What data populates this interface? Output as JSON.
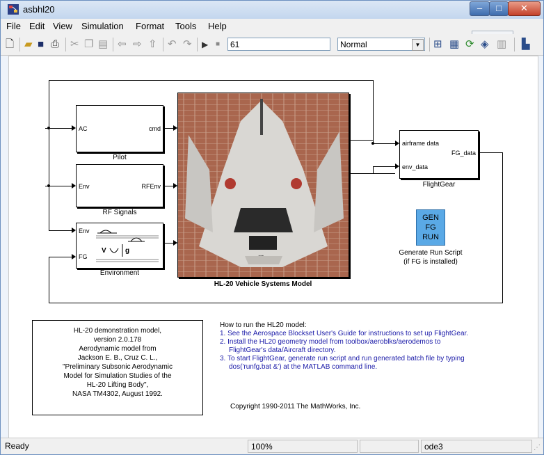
{
  "window": {
    "title": "asbhl20",
    "tooltip": "Minimize"
  },
  "menu": {
    "items": [
      "File",
      "Edit",
      "View",
      "Simulation",
      "Format",
      "Tools",
      "Help"
    ]
  },
  "toolbar": {
    "stop_time": "61",
    "sim_mode": "Normal"
  },
  "diagram": {
    "pilot": {
      "name": "Pilot",
      "in_port": "AC",
      "out_port": "cmd"
    },
    "rf": {
      "name": "RF Signals",
      "in_port": "Env",
      "out_port": "RFEnv"
    },
    "environment": {
      "name": "Environment",
      "in_port_1": "Env",
      "in_port_2": "FG"
    },
    "vehicle": {
      "name": "HL-20 Vehicle Systems Model",
      "ellipsis": "..."
    },
    "flightgear": {
      "name": "FlightGear",
      "in_port_1": "airframe data",
      "in_port_2": "env_data",
      "out_port": "FG_data"
    },
    "gen_script": {
      "icon_lines": [
        "GEN",
        "FG",
        "RUN"
      ],
      "caption_1": "Generate Run Script",
      "caption_2": "(if FG is installed)"
    },
    "info_box": [
      "HL-20 demonstration model,",
      "version 2.0.178",
      "Aerodynamic model from",
      "Jackson E. B., Cruz C. L.,",
      "\"Preliminary Subsonic Aerodynamic",
      "Model for Simulation Studies of the",
      "HL-20 Lifting Body\",",
      "NASA TM4302, August 1992."
    ],
    "howto_title": "How to run the HL20 model:",
    "howto_steps": [
      "1. See the Aerospace Blockset User's Guide for instructions to set up FlightGear.",
      "2. Install the HL20 geometry model from toolbox/aeroblks/aerodemos to",
      "FlightGear's data/Aircraft directory.",
      "3. To start FlightGear, generate run script and run generated batch file by typing",
      "dos('runfg.bat &') at the MATLAB command line."
    ],
    "copyright": "Copyright 1990-2011 The MathWorks, Inc."
  },
  "status": {
    "ready": "Ready",
    "zoom": "100%",
    "solver": "ode3"
  }
}
